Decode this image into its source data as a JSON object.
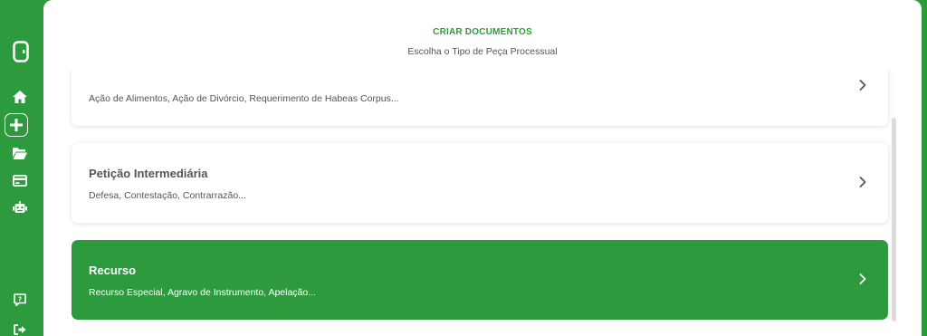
{
  "header": {
    "title": "CRIAR DOCUMENTOS",
    "subtitle": "Escolha o Tipo de Peça Processual"
  },
  "sidebar": {
    "items": [
      {
        "icon": "logo-icon",
        "label": ""
      },
      {
        "icon": "home-icon",
        "label": ""
      },
      {
        "icon": "plus-icon",
        "label": ""
      },
      {
        "icon": "folder-icon",
        "label": ""
      },
      {
        "icon": "card-icon",
        "label": ""
      },
      {
        "icon": "robot-icon",
        "label": ""
      },
      {
        "icon": "help-icon",
        "label": ""
      },
      {
        "icon": "logout-icon",
        "label": ""
      }
    ]
  },
  "documents": [
    {
      "title": "",
      "description": "Ação de Alimentos, Ação de Divórcio, Requerimento de Habeas Corpus..."
    },
    {
      "title": "Petição Intermediária",
      "description": "Defesa, Contestação, Contrarrazão..."
    },
    {
      "title": "Recurso",
      "description": "Recurso Especial, Agravo de Instrumento, Apelação..."
    }
  ],
  "colors": {
    "brand": "#2e9a3e",
    "text": "#555555",
    "card_bg": "#ffffff"
  }
}
